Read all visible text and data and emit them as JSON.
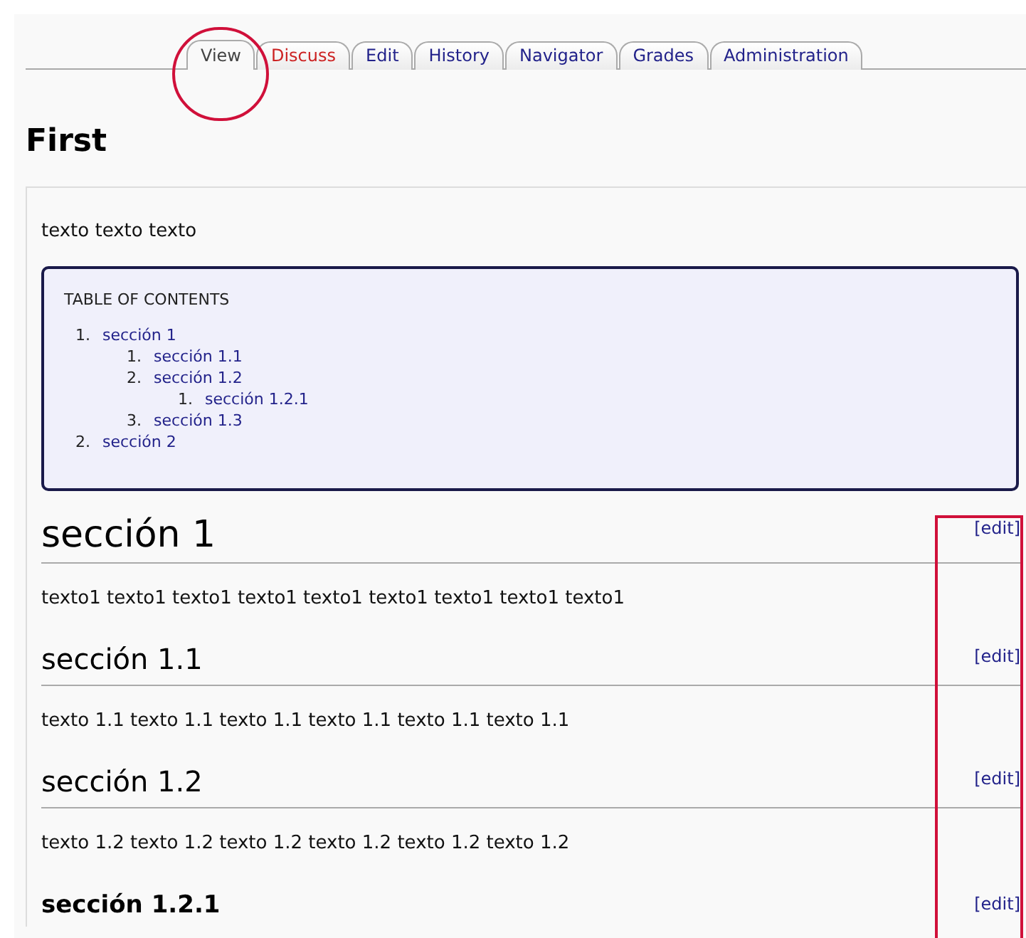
{
  "tabs": [
    {
      "label": "View",
      "selected": true,
      "kind": "link"
    },
    {
      "label": "Discuss",
      "selected": false,
      "kind": "missing"
    },
    {
      "label": "Edit",
      "selected": false,
      "kind": "link"
    },
    {
      "label": "History",
      "selected": false,
      "kind": "link"
    },
    {
      "label": "Navigator",
      "selected": false,
      "kind": "link"
    },
    {
      "label": "Grades",
      "selected": false,
      "kind": "link"
    },
    {
      "label": "Administration",
      "selected": false,
      "kind": "link"
    }
  ],
  "page_title": "First",
  "intro": "texto texto texto",
  "toc": {
    "title": "TABLE OF CONTENTS",
    "items": [
      {
        "number": "1.",
        "label": "sección 1",
        "children": [
          {
            "number": "1.",
            "label": "sección 1.1"
          },
          {
            "number": "2.",
            "label": "sección 1.2",
            "children": [
              {
                "number": "1.",
                "label": "sección 1.2.1"
              }
            ]
          },
          {
            "number": "3.",
            "label": "sección 1.3"
          }
        ]
      },
      {
        "number": "2.",
        "label": "sección 2"
      }
    ]
  },
  "sections": [
    {
      "kind": "h1",
      "heading": "sección 1",
      "edit_link": "[edit]",
      "text": "texto1 texto1 texto1 texto1 texto1 texto1 texto1 texto1 texto1"
    },
    {
      "kind": "h2",
      "heading": "sección 1.1",
      "edit_link": "[edit]",
      "text": "texto 1.1 texto 1.1 texto 1.1 texto 1.1 texto 1.1 texto 1.1"
    },
    {
      "kind": "h2",
      "heading": "sección 1.2",
      "edit_link": "[edit]",
      "text": "texto 1.2 texto 1.2 texto 1.2 texto 1.2 texto 1.2 texto 1.2"
    },
    {
      "kind": "h3",
      "heading": "sección 1.2.1",
      "edit_link": "[edit]"
    }
  ],
  "annotations": [
    {
      "kind": "circle"
    },
    {
      "kind": "rectangle"
    }
  ]
}
